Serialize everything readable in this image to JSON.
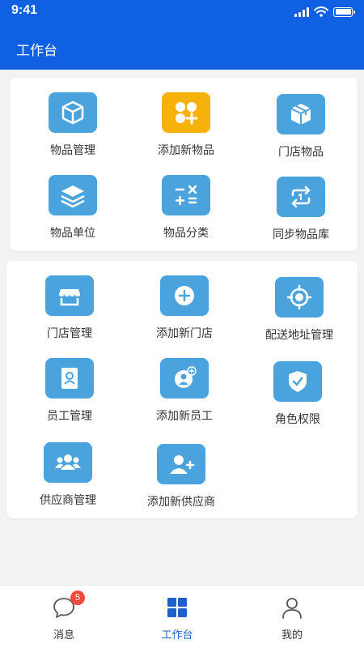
{
  "status_bar": {
    "time": "9:41"
  },
  "header": {
    "title": "工作台"
  },
  "colors": {
    "brand": "#1060e4",
    "icon_blue": "#4ba3de",
    "icon_yellow": "#f6b20a",
    "tab_active": "#1f5fc9",
    "badge": "#f04a3c"
  },
  "section1": {
    "items": [
      {
        "label": "物品管理",
        "icon": "cube-icon"
      },
      {
        "label": "添加新物品",
        "icon": "add-grid-icon"
      },
      {
        "label": "门店物品",
        "icon": "package-icon"
      },
      {
        "label": "物品单位",
        "icon": "layers-icon"
      },
      {
        "label": "物品分类",
        "icon": "calculator-icon"
      },
      {
        "label": "同步物品库",
        "icon": "sync-icon"
      }
    ]
  },
  "section2": {
    "items": [
      {
        "label": "门店管理",
        "icon": "store-icon"
      },
      {
        "label": "添加新门店",
        "icon": "add-circle-icon"
      },
      {
        "label": "配送地址管理",
        "icon": "target-icon"
      },
      {
        "label": "员工管理",
        "icon": "id-card-icon"
      },
      {
        "label": "添加新员工",
        "icon": "add-user-icon"
      },
      {
        "label": "角色权限",
        "icon": "shield-icon"
      },
      {
        "label": "供应商管理",
        "icon": "group-icon"
      },
      {
        "label": "添加新供应商",
        "icon": "add-person-icon"
      }
    ]
  },
  "tabbar": {
    "messages": {
      "label": "消息",
      "badge": "5"
    },
    "workbench": {
      "label": "工作台"
    },
    "mine": {
      "label": "我的"
    }
  }
}
